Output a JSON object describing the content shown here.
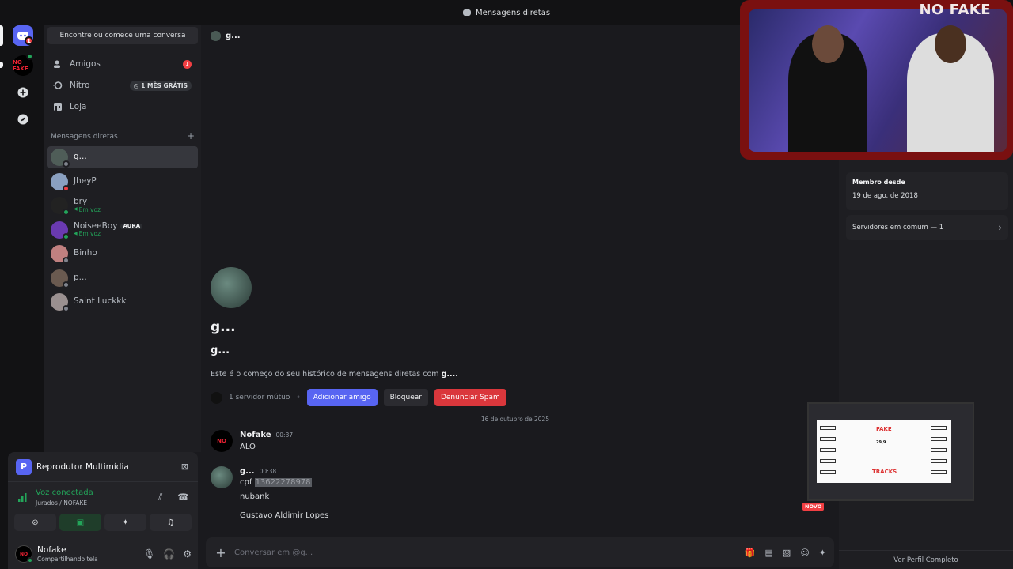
{
  "titlebar": {
    "title": "Mensagens diretas"
  },
  "rail": {
    "home_badge": "1",
    "server_label": "NO FAKE"
  },
  "sidebar": {
    "find_label": "Encontre ou comece uma conversa",
    "nav": [
      {
        "label": "Amigos",
        "badge": "1"
      },
      {
        "label": "Nitro",
        "pill": "1 MÊS GRÁTIS"
      },
      {
        "label": "Loja"
      }
    ],
    "dm_header": "Mensagens diretas",
    "dm_add": "+",
    "dms": [
      {
        "name": "g...",
        "sub": "",
        "status": "off",
        "color": "#4f5d58"
      },
      {
        "name": "JheyP",
        "sub": "",
        "status": "dnd",
        "color": "#8aa0c0"
      },
      {
        "name": "bry",
        "sub": "Em voz",
        "status": "on",
        "color": "#222"
      },
      {
        "name": "NoiseeBoy",
        "sub": "Em voz",
        "status": "on",
        "color": "#6a3ab0",
        "tag": "AURA"
      },
      {
        "name": "Binho",
        "sub": "",
        "status": "off",
        "color": "#c08080"
      },
      {
        "name": "p...",
        "sub": "",
        "status": "off",
        "color": "#6a5a50"
      },
      {
        "name": "Saint Luckkk",
        "sub": "",
        "status": "off",
        "color": "#9a9090"
      }
    ]
  },
  "voice": {
    "media_title": "Reprodutor Multimídia",
    "media_icon": "P",
    "connected": "Voz conectada",
    "channel": "Jurados / NOFAKE"
  },
  "user": {
    "name": "Nofake",
    "status": "Compartilhando tela",
    "avatar_text": "NO"
  },
  "chat": {
    "header_name": "g...",
    "intro_name": "g...",
    "intro_user": "g...",
    "intro_desc_prefix": "Este é o começo do seu histórico de mensagens diretas com ",
    "intro_desc_name": "g....",
    "mutual": "1 servidor mútuo",
    "add_friend": "Adicionar amigo",
    "block": "Bloquear",
    "report": "Denunciar Spam",
    "date_divider": "16 de outubro de 2025",
    "messages": [
      {
        "author": "Nofake",
        "time": "00:37",
        "lines": [
          "ALO"
        ]
      },
      {
        "author": "g...",
        "time": "00:38",
        "cpf_label": "cpf",
        "cpf_value": "13622278978",
        "lines": [
          "nubank"
        ]
      }
    ],
    "new_tag": "NOVO",
    "new_message": "Gustavo Aldimir Lopes",
    "composer_placeholder": "Conversar em @g..."
  },
  "profile": {
    "member_since_label": "Membro desde",
    "member_since": "19 de ago. de 2018",
    "mutual_servers": "Servidores em comum — 1",
    "full_profile": "Ver Perfil Completo"
  },
  "cam": {
    "title": "NO FAKE"
  },
  "thumb": {
    "fake": "FAKE",
    "tracks": "TRACKS",
    "score": "29,9"
  }
}
